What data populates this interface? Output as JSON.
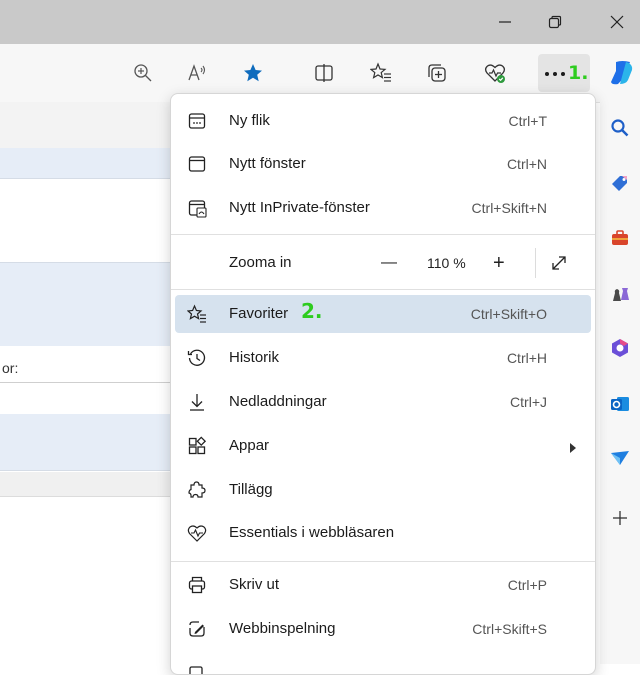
{
  "window": {
    "minimize_icon": "minimize-icon",
    "restore_icon": "restore-icon",
    "close_icon": "close-icon"
  },
  "toolbar": {
    "more_annotation": "1."
  },
  "page": {
    "partial_label": "or:"
  },
  "menu": {
    "items": [
      {
        "label": "Ny flik",
        "shortcut": "Ctrl+T"
      },
      {
        "label": "Nytt fönster",
        "shortcut": "Ctrl+N"
      },
      {
        "label": "Nytt InPrivate-fönster",
        "shortcut": "Ctrl+Skift+N"
      },
      {
        "label": "Favoriter",
        "shortcut": "Ctrl+Skift+O",
        "annotation": "2."
      },
      {
        "label": "Historik",
        "shortcut": "Ctrl+H"
      },
      {
        "label": "Nedladdningar",
        "shortcut": "Ctrl+J"
      },
      {
        "label": "Appar",
        "shortcut": ""
      },
      {
        "label": "Tillägg",
        "shortcut": ""
      },
      {
        "label": "Essentials i webbläsaren",
        "shortcut": ""
      },
      {
        "label": "Skriv ut",
        "shortcut": "Ctrl+P"
      },
      {
        "label": "Webbinspelning",
        "shortcut": "Ctrl+Skift+S"
      }
    ],
    "zoom": {
      "label": "Zooma in",
      "minus": "—",
      "value": "110 %",
      "plus": "+"
    }
  },
  "colors": {
    "highlight": "#d6e2ee",
    "annotation": "#2ecc1f",
    "favorite_star": "#0f6cbd"
  }
}
